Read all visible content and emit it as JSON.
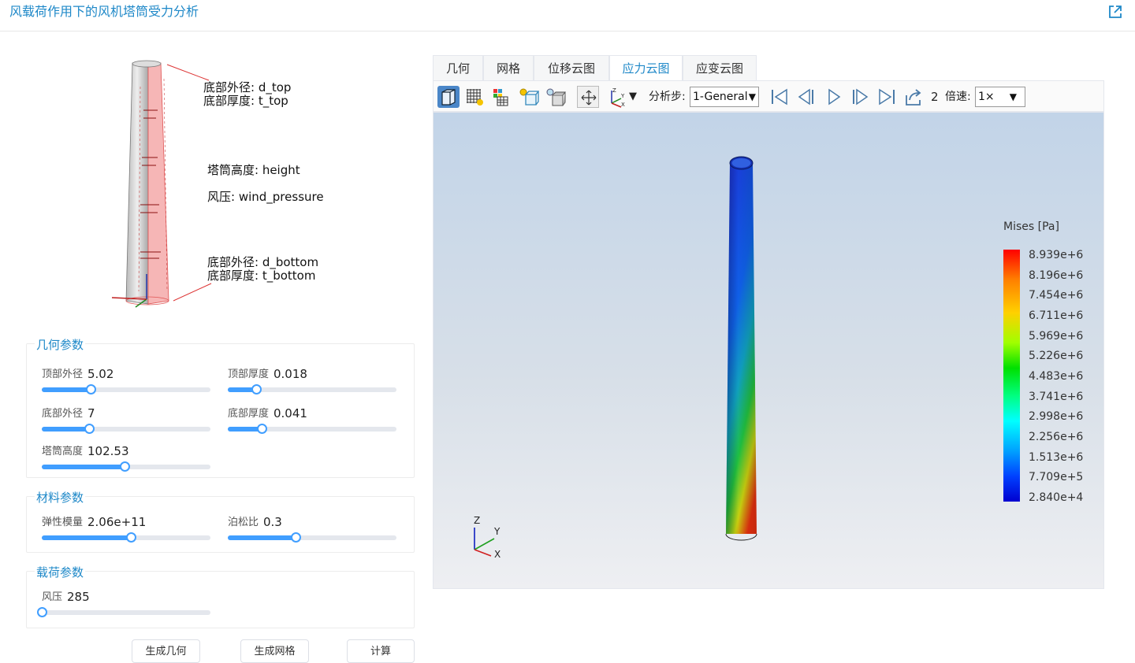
{
  "header": {
    "title": "风载荷作用下的风机塔筒受力分析",
    "external_link_icon": "external-link-icon"
  },
  "diagram": {
    "labels": {
      "top_d": "底部外径: d_top",
      "top_t": "底部厚度: t_top",
      "height": "塔筒高度: height",
      "wind": "风压: wind_pressure",
      "bottom_d": "底部外径: d_bottom",
      "bottom_t": "底部厚度: t_bottom"
    }
  },
  "geometry": {
    "title": "几何参数",
    "params": [
      {
        "label": "顶部外径",
        "value": "5.02",
        "fraction": 0.29
      },
      {
        "label": "顶部厚度",
        "value": "0.018",
        "fraction": 0.17
      },
      {
        "label": "底部外径",
        "value": "7",
        "fraction": 0.28
      },
      {
        "label": "底部厚度",
        "value": "0.041",
        "fraction": 0.2
      },
      {
        "label": "塔筒高度",
        "value": "102.53",
        "fraction": 0.49
      }
    ]
  },
  "material": {
    "title": "材料参数",
    "params": [
      {
        "label": "弹性模量",
        "value": "2.06e+11",
        "fraction": 0.53
      },
      {
        "label": "泊松比",
        "value": "0.3",
        "fraction": 0.4
      }
    ]
  },
  "load": {
    "title": "载荷参数",
    "params": [
      {
        "label": "风压",
        "value": "285",
        "fraction": 0.0
      }
    ]
  },
  "actions": {
    "generate_geometry": "生成几何",
    "generate_mesh": "生成网格",
    "compute": "计算"
  },
  "tabs": [
    {
      "label": "几何",
      "active": false
    },
    {
      "label": "网格",
      "active": false
    },
    {
      "label": "位移云图",
      "active": false
    },
    {
      "label": "应力云图",
      "active": true
    },
    {
      "label": "应变云图",
      "active": false
    }
  ],
  "toolbar": {
    "step_label": "分析步:",
    "step_value": "1-General",
    "frame_value": "2",
    "speed_label": "倍速:",
    "speed_value": "1×",
    "icons": [
      "solid-view-icon",
      "mesh-view-icon",
      "color-grid-icon",
      "light-box-icon",
      "light-cube-icon",
      "fit-view-icon",
      "axes-orientation-icon",
      "first-frame-icon",
      "previous-frame-icon",
      "play-icon",
      "next-frame-icon",
      "last-frame-icon",
      "export-icon"
    ]
  },
  "legend": {
    "title": "Mises [Pa]",
    "values": [
      "8.939e+6",
      "8.196e+6",
      "7.454e+6",
      "6.711e+6",
      "5.969e+6",
      "5.226e+6",
      "4.483e+6",
      "3.741e+6",
      "2.998e+6",
      "2.256e+6",
      "1.513e+6",
      "7.709e+5",
      "2.840e+4"
    ],
    "colors": {
      "max": "#ff0000",
      "min": "#0000d0"
    }
  },
  "axes": {
    "z": "Z",
    "y": "Y",
    "x": "X"
  },
  "colors": {
    "accent": "#1e88c8",
    "slider": "#409eff"
  }
}
